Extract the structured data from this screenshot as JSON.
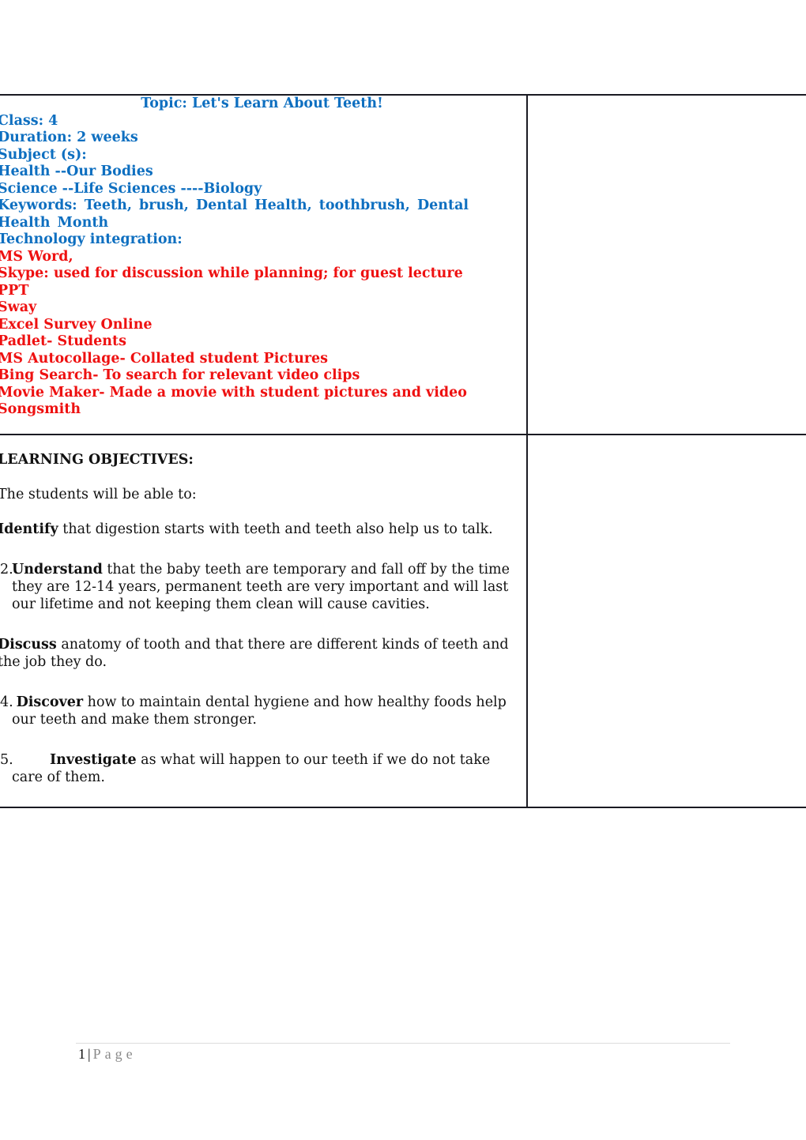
{
  "colors": {
    "heading_blue": "#0e6fc0",
    "tech_red": "#ee1111",
    "body_text": "#111111",
    "border": "#1a1a22"
  },
  "lesson": {
    "topic": "Topic: Let's Learn About Teeth!",
    "class": "Class: 4",
    "duration": "Duration: 2 weeks",
    "subjects_label": "Subject (s):",
    "subjects": [
      "Health --Our Bodies",
      "Science --Life Sciences ----Biology"
    ],
    "keywords": "Keywords: Teeth, brush, Dental Health, toothbrush, Dental Health Month",
    "tech_label": "Technology integration:",
    "tech_items": [
      "MS Word,",
      "Skype: used for discussion while planning; for guest lecture",
      "PPT",
      "Sway",
      "Excel Survey Online",
      "Padlet- Students",
      "MS Autocollage- Collated student Pictures",
      "Bing Search- To search for relevant video clips",
      "Movie Maker- Made a movie with student pictures and video",
      "Songsmith"
    ]
  },
  "objectives": {
    "title": "LEARNING OBJECTIVES:",
    "intro": "The students will be able to:",
    "items": [
      {
        "num": "",
        "verb": "Identify",
        "text": " that digestion starts with teeth and teeth also help us to talk."
      },
      {
        "num": "2.",
        "verb": "Understand",
        "text": " that the baby teeth are temporary and fall off by the time they are 12-14 years, permanent teeth are very important and will last our lifetime and not keeping them clean will cause cavities."
      },
      {
        "num": "",
        "verb": "Discuss",
        "text": " anatomy of tooth and that there are different kinds of teeth and the job they do."
      },
      {
        "num": "4.",
        "verb": "Discover",
        "text": " how to maintain dental hygiene and how healthy foods help our teeth and make them stronger."
      },
      {
        "num": "5.",
        "verb": "Investigate",
        "text": " as what will happen to our teeth if we do not take care of them."
      }
    ]
  },
  "footer": {
    "page_number": "1",
    "separator": "|",
    "page_word": "Page"
  }
}
